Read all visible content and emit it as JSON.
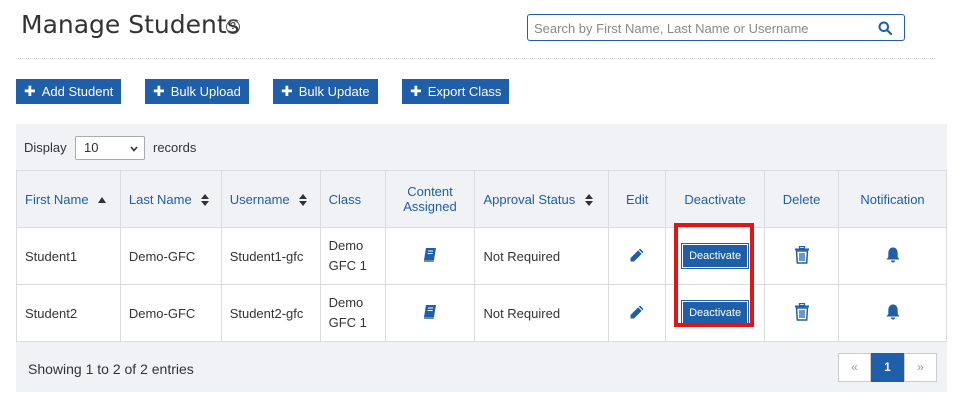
{
  "page": {
    "title": "Manage Students",
    "help_icon": "?"
  },
  "search": {
    "placeholder": "Search by First Name, Last Name or Username",
    "value": ""
  },
  "actions": {
    "add_student": "Add Student",
    "bulk_upload": "Bulk Upload",
    "bulk_update": "Bulk Update",
    "export_class": "Export Class",
    "icon": "plus-icon"
  },
  "display": {
    "label": "Display",
    "selected": "10",
    "suffix": "records"
  },
  "table": {
    "headers": {
      "first_name": "First Name",
      "last_name": "Last Name",
      "username": "Username",
      "class": "Class",
      "content_assigned": "Content Assigned",
      "approval_status": "Approval Status",
      "edit": "Edit",
      "deactivate": "Deactivate",
      "delete": "Delete",
      "notification": "Notification"
    },
    "rows": [
      {
        "first_name": "Student1",
        "last_name": "Demo-GFC",
        "username": "Student1-gfc",
        "class": "Demo GFC 1",
        "approval_status": "Not Required",
        "deactivate_label": "Deactivate"
      },
      {
        "first_name": "Student2",
        "last_name": "Demo-GFC",
        "username": "Student2-gfc",
        "class": "Demo GFC 1",
        "approval_status": "Not Required",
        "deactivate_label": "Deactivate"
      }
    ]
  },
  "footer": {
    "info": "Showing 1 to 2 of 2 entries",
    "prev": "«",
    "current_page": "1",
    "next": "»"
  },
  "colors": {
    "primary": "#1f5ea8",
    "highlight": "#e01515",
    "panel": "#f0f2f5"
  }
}
